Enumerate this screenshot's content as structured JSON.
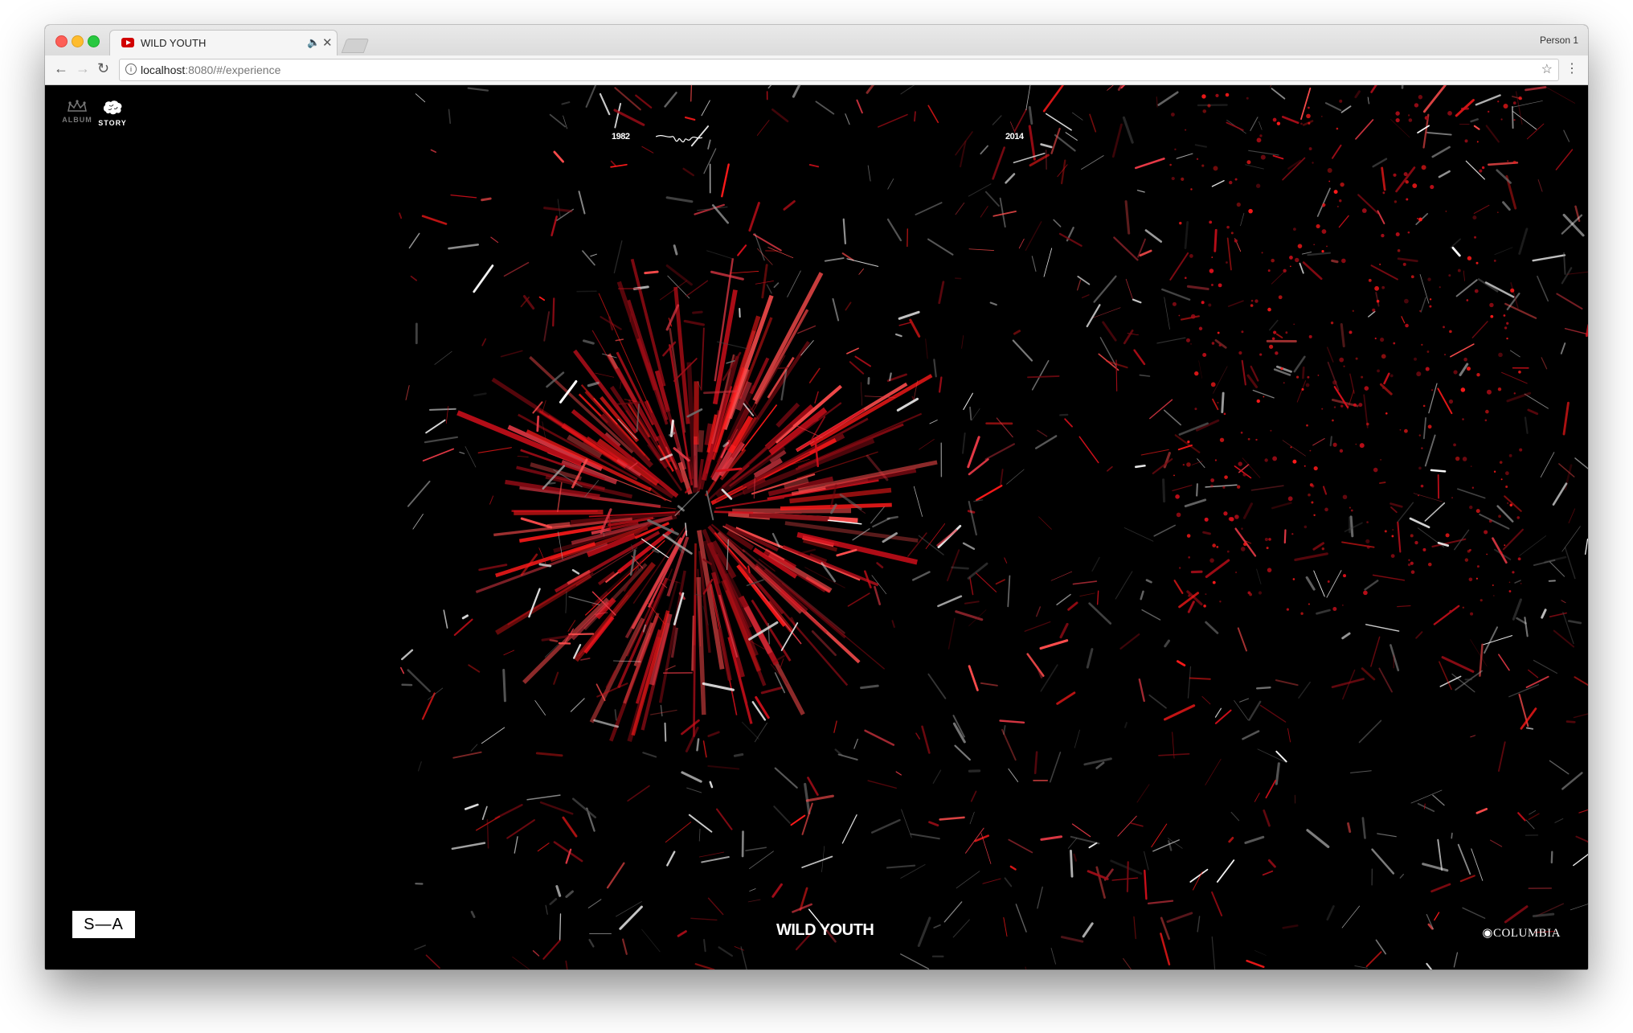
{
  "browser": {
    "tab_title": "WILD YOUTH",
    "profile": "Person 1",
    "url_host": "localhost",
    "url_rest": ":8080/#/experience"
  },
  "nav": {
    "album_label": "ALBUM",
    "story_label": "STORY"
  },
  "timeline": {
    "start_year": "1982",
    "end_year": "2014"
  },
  "footer": {
    "sa_logo": "S—A",
    "title": "WILD YOUTH",
    "label": "COLUMBIA"
  },
  "colors": {
    "background": "#000000",
    "accent": "#e0141e"
  }
}
